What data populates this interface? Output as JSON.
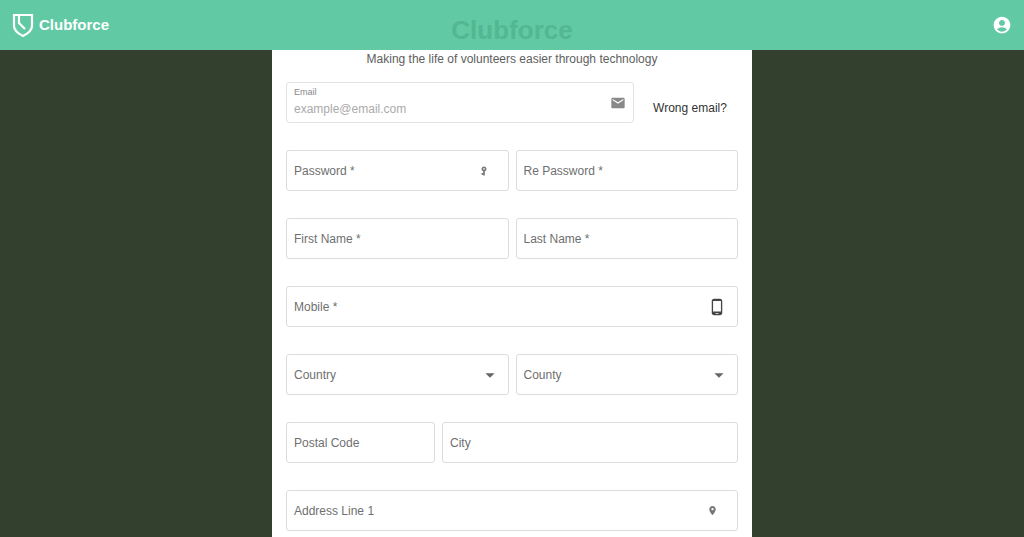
{
  "header": {
    "brand": "Clubforce",
    "watermark": "Clubforce"
  },
  "subtitle": "Making the life of volunteers easier through technology",
  "email": {
    "label": "Email",
    "placeholder": "example@email.com",
    "link": "Wrong email?"
  },
  "rows": [
    [
      {
        "label": "Password *",
        "kind": "password"
      },
      {
        "label": "Re Password *",
        "kind": "text"
      }
    ],
    [
      {
        "label": "First Name *",
        "kind": "text"
      },
      {
        "label": "Last Name *",
        "kind": "text"
      }
    ],
    [
      {
        "label": "Mobile *",
        "kind": "phone"
      }
    ],
    [
      {
        "label": "Country",
        "kind": "select"
      },
      {
        "label": "County",
        "kind": "select"
      }
    ],
    [
      {
        "label": "Postal Code",
        "kind": "short"
      },
      {
        "label": "City",
        "kind": "text"
      }
    ],
    [
      {
        "label": "Address Line 1",
        "kind": "address"
      }
    ]
  ]
}
